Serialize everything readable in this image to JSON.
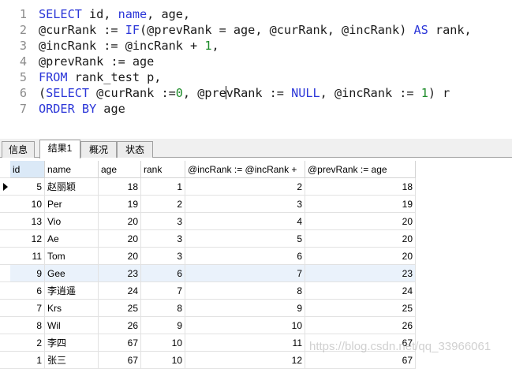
{
  "editor": {
    "lines": [
      {
        "n": "1",
        "parts": [
          [
            "kw",
            "SELECT"
          ],
          [
            "id",
            " id, "
          ],
          [
            "kw",
            "name"
          ],
          [
            "id",
            ", age,"
          ]
        ]
      },
      {
        "n": "2",
        "parts": [
          [
            "id",
            "@curRank := "
          ],
          [
            "kw",
            "IF"
          ],
          [
            "id",
            "(@prevRank = age, @curRank, @incRank) "
          ],
          [
            "kw",
            "AS"
          ],
          [
            "id",
            " rank,"
          ]
        ]
      },
      {
        "n": "3",
        "parts": [
          [
            "id",
            "@incRank := @incRank + "
          ],
          [
            "num",
            "1"
          ],
          [
            "id",
            ","
          ]
        ]
      },
      {
        "n": "4",
        "parts": [
          [
            "id",
            "@prevRank := age"
          ]
        ]
      },
      {
        "n": "5",
        "parts": [
          [
            "kw",
            "FROM"
          ],
          [
            "id",
            " rank_test p,"
          ]
        ]
      },
      {
        "n": "6",
        "parts": [
          [
            "id",
            "("
          ],
          [
            "kw",
            "SELECT"
          ],
          [
            "id",
            " @curRank :="
          ],
          [
            "num",
            "0"
          ],
          [
            "id",
            ", @pre"
          ],
          [
            "caret",
            ""
          ],
          [
            "id",
            "vRank := "
          ],
          [
            "kw",
            "NULL"
          ],
          [
            "id",
            ", @incRank := "
          ],
          [
            "num",
            "1"
          ],
          [
            "id",
            ") r"
          ]
        ]
      },
      {
        "n": "7",
        "parts": [
          [
            "kw",
            "ORDER BY"
          ],
          [
            "id",
            " age"
          ]
        ]
      }
    ]
  },
  "tabs": [
    {
      "label": "信息",
      "active": false
    },
    {
      "label": "结果1",
      "active": true
    },
    {
      "label": "概况",
      "active": false
    },
    {
      "label": "状态",
      "active": false
    }
  ],
  "grid": {
    "columns": [
      "id",
      "name",
      "age",
      "rank",
      "@incRank := @incRank +",
      "@prevRank := age"
    ],
    "rows": [
      [
        "5",
        "赵丽颖",
        "18",
        "1",
        "2",
        "18"
      ],
      [
        "10",
        "Per",
        "19",
        "2",
        "3",
        "19"
      ],
      [
        "13",
        "Vio",
        "20",
        "3",
        "4",
        "20"
      ],
      [
        "12",
        "Ae",
        "20",
        "3",
        "5",
        "20"
      ],
      [
        "11",
        "Tom",
        "20",
        "3",
        "6",
        "20"
      ],
      [
        "9",
        "Gee",
        "23",
        "6",
        "7",
        "23"
      ],
      [
        "6",
        "李逍遥",
        "24",
        "7",
        "8",
        "24"
      ],
      [
        "7",
        "Krs",
        "25",
        "8",
        "9",
        "25"
      ],
      [
        "8",
        "Wil",
        "26",
        "9",
        "10",
        "26"
      ],
      [
        "2",
        "李四",
        "67",
        "10",
        "11",
        "67"
      ],
      [
        "1",
        "张三",
        "67",
        "10",
        "12",
        "67"
      ]
    ],
    "current_row": 0,
    "highlighted_row": 5
  },
  "watermark": "https://blog.csdn.net/qq_33966061"
}
